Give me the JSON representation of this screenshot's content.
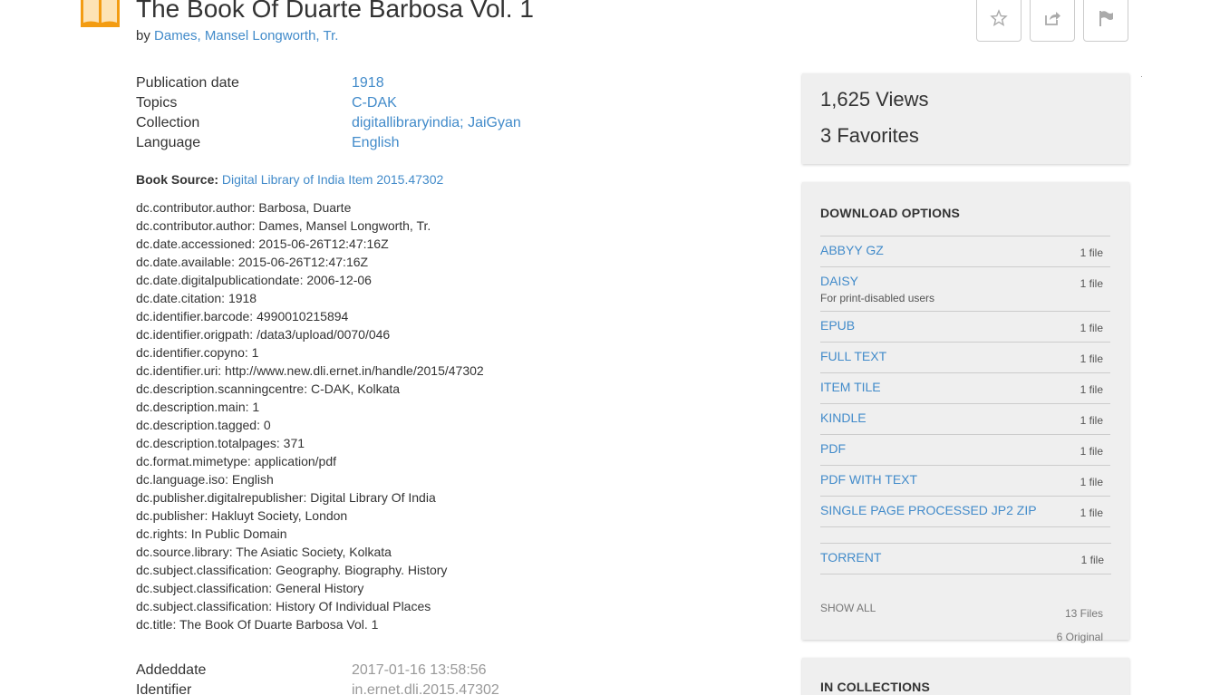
{
  "header": {
    "title": "The Book Of Duarte Barbosa Vol. 1",
    "by_prefix": "by",
    "author": "Dames, Mansel Longworth, Tr.",
    "icon": "book-icon",
    "actions": [
      {
        "name": "favorite-button",
        "icon": "star-icon"
      },
      {
        "name": "share-button",
        "icon": "share-icon"
      },
      {
        "name": "flag-button",
        "icon": "flag-icon"
      }
    ]
  },
  "metadata": {
    "publication_date": {
      "key": "Publication date",
      "value": "1918"
    },
    "topics": {
      "key": "Topics",
      "value": "C-DAK"
    },
    "collection": {
      "key": "Collection",
      "value1": "digitallibraryindia",
      "separator": ";",
      "value2": "JaiGyan"
    },
    "language": {
      "key": "Language",
      "value": "English"
    }
  },
  "book_source": {
    "label": "Book Source:",
    "link": "Digital Library of India Item 2015.47302"
  },
  "dc_lines": [
    "dc.contributor.author: Barbosa, Duarte",
    "dc.contributor.author: Dames, Mansel Longworth, Tr.",
    "dc.date.accessioned: 2015-06-26T12:47:16Z",
    "dc.date.available: 2015-06-26T12:47:16Z",
    "dc.date.digitalpublicationdate: 2006-12-06",
    "dc.date.citation: 1918",
    "dc.identifier.barcode: 4990010215894",
    "dc.identifier.origpath: /data3/upload/0070/046",
    "dc.identifier.copyno: 1",
    "dc.identifier.uri: http://www.new.dli.ernet.in/handle/2015/47302",
    "dc.description.scanningcentre: C-DAK, Kolkata",
    "dc.description.main: 1",
    "dc.description.tagged: 0",
    "dc.description.totalpages: 371",
    "dc.format.mimetype: application/pdf",
    "dc.language.iso: English",
    "dc.publisher.digitalrepublisher: Digital Library Of India",
    "dc.publisher: Hakluyt Society, London",
    "dc.rights: In Public Domain",
    "dc.source.library: The Asiatic Society, Kolkata",
    "dc.subject.classification: Geography. Biography. History",
    "dc.subject.classification: General History",
    "dc.subject.classification: History Of Individual Places",
    "dc.title: The Book Of Duarte Barbosa Vol. 1"
  ],
  "bottom_meta": {
    "addeddate": {
      "key": "Addeddate",
      "value": "2017-01-16 13:58:56"
    },
    "identifier": {
      "key": "Identifier",
      "value": "in.ernet.dli.2015.47302"
    }
  },
  "stats": {
    "views": "1,625 Views",
    "favorites": "3 Favorites"
  },
  "downloads": {
    "heading": "DOWNLOAD OPTIONS",
    "items": [
      {
        "name": "ABBYY GZ",
        "count": "1 file",
        "sub": ""
      },
      {
        "name": "DAISY",
        "count": "1 file",
        "sub": "For print-disabled users"
      },
      {
        "name": "EPUB",
        "count": "1 file",
        "sub": ""
      },
      {
        "name": "FULL TEXT",
        "count": "1 file",
        "sub": ""
      },
      {
        "name": "ITEM TILE",
        "count": "1 file",
        "sub": ""
      },
      {
        "name": "KINDLE",
        "count": "1 file",
        "sub": ""
      },
      {
        "name": "PDF",
        "count": "1 file",
        "sub": ""
      },
      {
        "name": "PDF WITH TEXT",
        "count": "1 file",
        "sub": ""
      },
      {
        "name": "SINGLE PAGE PROCESSED JP2 ZIP",
        "count": "1 file",
        "sub": ""
      }
    ],
    "torrent": {
      "name": "TORRENT",
      "count": "1 file"
    },
    "show_all": "SHOW ALL",
    "total_files": "13 Files",
    "original_files": "6 Original"
  },
  "collections": {
    "heading": "IN COLLECTIONS"
  },
  "colors": {
    "link": "#428bca",
    "panel_bg": "#efefef",
    "book_icon": "#f0a030"
  }
}
